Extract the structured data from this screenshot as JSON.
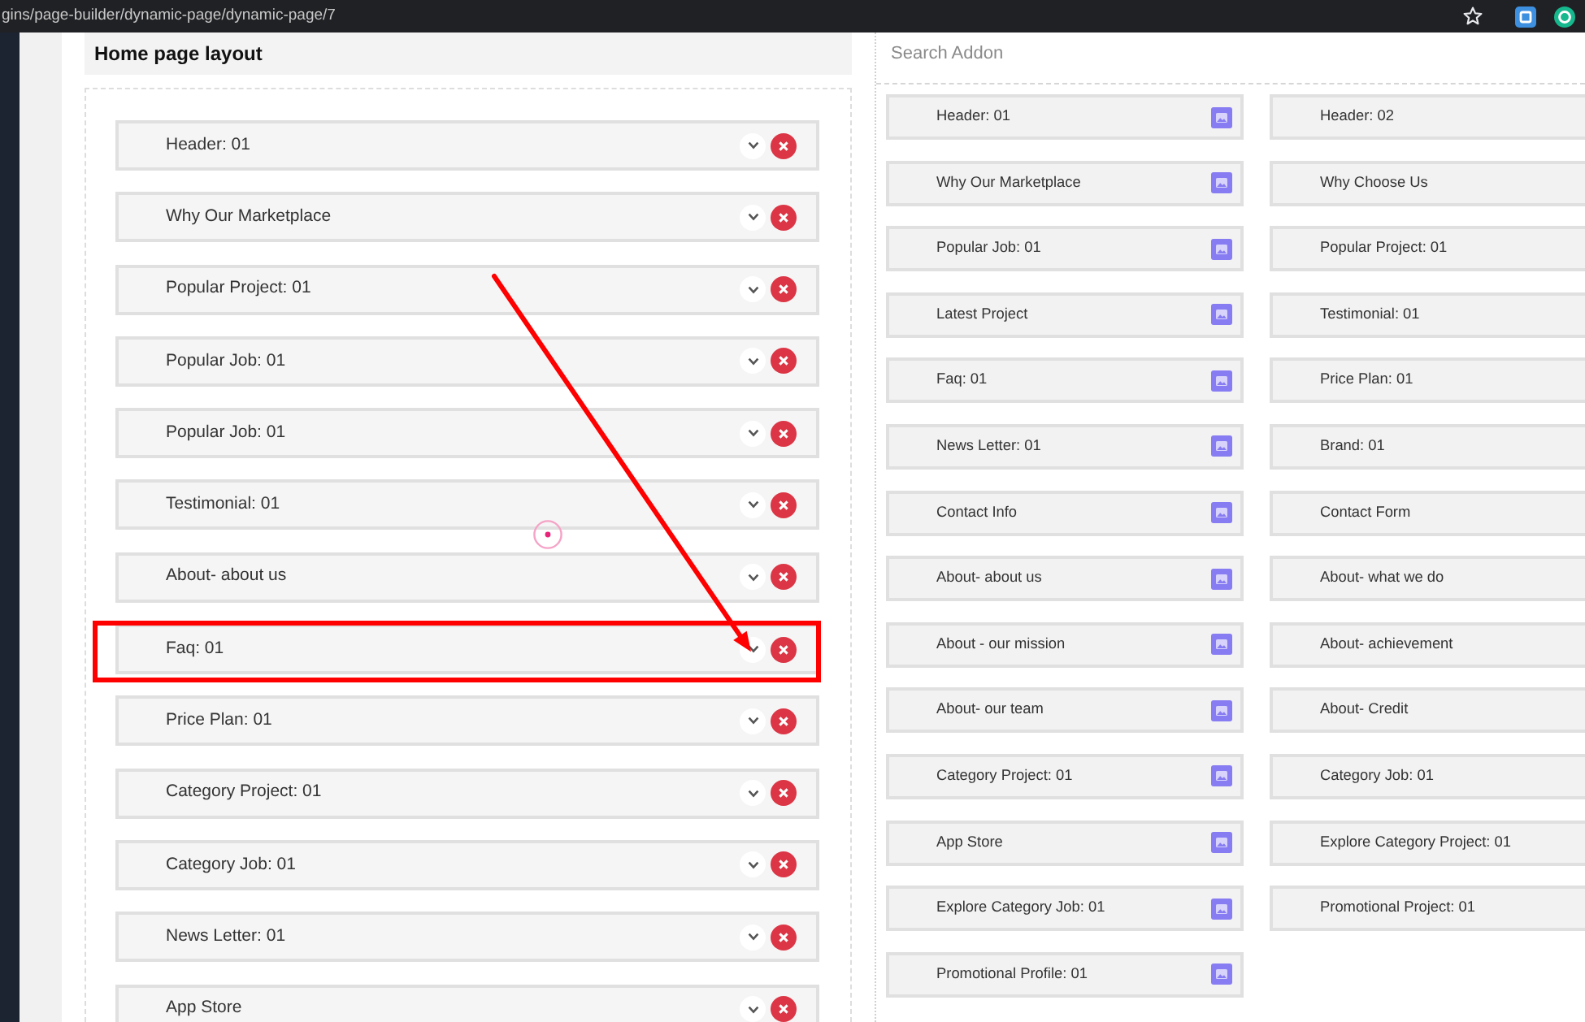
{
  "browser": {
    "url": "gins/page-builder/dynamic-page/dynamic-page/7"
  },
  "layout": {
    "title": "Home page layout",
    "items": [
      {
        "label": "Header: 01",
        "highlighted": false
      },
      {
        "label": "Why Our Marketplace",
        "highlighted": false
      },
      {
        "label": "Popular Project: 01",
        "highlighted": false
      },
      {
        "label": "Popular Job: 01",
        "highlighted": false
      },
      {
        "label": "Popular Job: 01",
        "highlighted": false
      },
      {
        "label": "Testimonial: 01",
        "highlighted": false
      },
      {
        "label": "About- about us",
        "highlighted": false
      },
      {
        "label": "Faq: 01",
        "highlighted": true
      },
      {
        "label": "Price Plan: 01",
        "highlighted": false
      },
      {
        "label": "Category Project: 01",
        "highlighted": false
      },
      {
        "label": "Category Job: 01",
        "highlighted": false
      },
      {
        "label": "News Letter: 01",
        "highlighted": false
      },
      {
        "label": "App Store",
        "highlighted": false
      }
    ]
  },
  "addons": {
    "search": {
      "placeholder": "Search Addon"
    },
    "items": [
      {
        "label": "Header: 01",
        "icon": true
      },
      {
        "label": "Header: 02",
        "icon": false
      },
      {
        "label": "Why Our Marketplace",
        "icon": true
      },
      {
        "label": "Why Choose Us",
        "icon": false
      },
      {
        "label": "Popular Job: 01",
        "icon": true
      },
      {
        "label": "Popular Project: 01",
        "icon": false
      },
      {
        "label": "Latest Project",
        "icon": true
      },
      {
        "label": "Testimonial: 01",
        "icon": false
      },
      {
        "label": "Faq: 01",
        "icon": true
      },
      {
        "label": "Price Plan: 01",
        "icon": false
      },
      {
        "label": "News Letter: 01",
        "icon": true
      },
      {
        "label": "Brand: 01",
        "icon": false
      },
      {
        "label": "Contact Info",
        "icon": true
      },
      {
        "label": "Contact Form",
        "icon": false
      },
      {
        "label": "About- about us",
        "icon": true
      },
      {
        "label": "About- what we do",
        "icon": false
      },
      {
        "label": "About - our mission",
        "icon": true
      },
      {
        "label": "About- achievement",
        "icon": false
      },
      {
        "label": "About- our team",
        "icon": true
      },
      {
        "label": "About- Credit",
        "icon": false
      },
      {
        "label": "Category Project: 01",
        "icon": true
      },
      {
        "label": "Category Job: 01",
        "icon": false
      },
      {
        "label": "App Store",
        "icon": true
      },
      {
        "label": "Explore Category Project: 01",
        "icon": false
      },
      {
        "label": "Explore Category Job: 01",
        "icon": true
      },
      {
        "label": "Promotional Project: 01",
        "icon": false
      },
      {
        "label": "Promotional Profile: 01",
        "icon": true
      }
    ]
  }
}
